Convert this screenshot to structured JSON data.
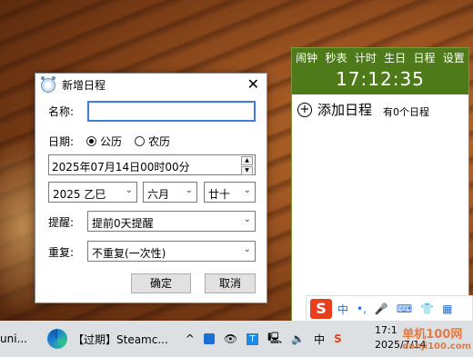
{
  "dialog": {
    "title": "新增日程",
    "close_glyph": "✕",
    "name_label": "名称:",
    "name_value": "",
    "date_label": "日期:",
    "radio_solar": "公历",
    "radio_lunar": "农历",
    "datetime_value": "2025年07月14日00时00分",
    "year_value": "2025 乙巳",
    "month_value": "六月",
    "day_value": "廿十",
    "remind_label": "提醒:",
    "remind_value": "提前0天提醒",
    "repeat_label": "重复:",
    "repeat_value": "不重复(一次性)",
    "ok_label": "确定",
    "cancel_label": "取消"
  },
  "widget": {
    "tabs": [
      "闹钟",
      "秒表",
      "计时",
      "生日",
      "日程",
      "设置"
    ],
    "time": "17:12:35",
    "add_label": "添加日程",
    "count_label": "有0个日程"
  },
  "ime": {
    "lang": "中",
    "punct": "•,",
    "mic": "🎤",
    "keyboard": "⌨",
    "shirt": "👕",
    "grid": "▦"
  },
  "taskbar": {
    "left_label": "uni...",
    "app_label": "【过期】Steamc...",
    "tray_chevron": "^",
    "tray_lang": "中",
    "date": "2025/7/14",
    "time_partial": "17:1"
  },
  "watermark": "单机100网",
  "watermark_sub": "danji100.com"
}
